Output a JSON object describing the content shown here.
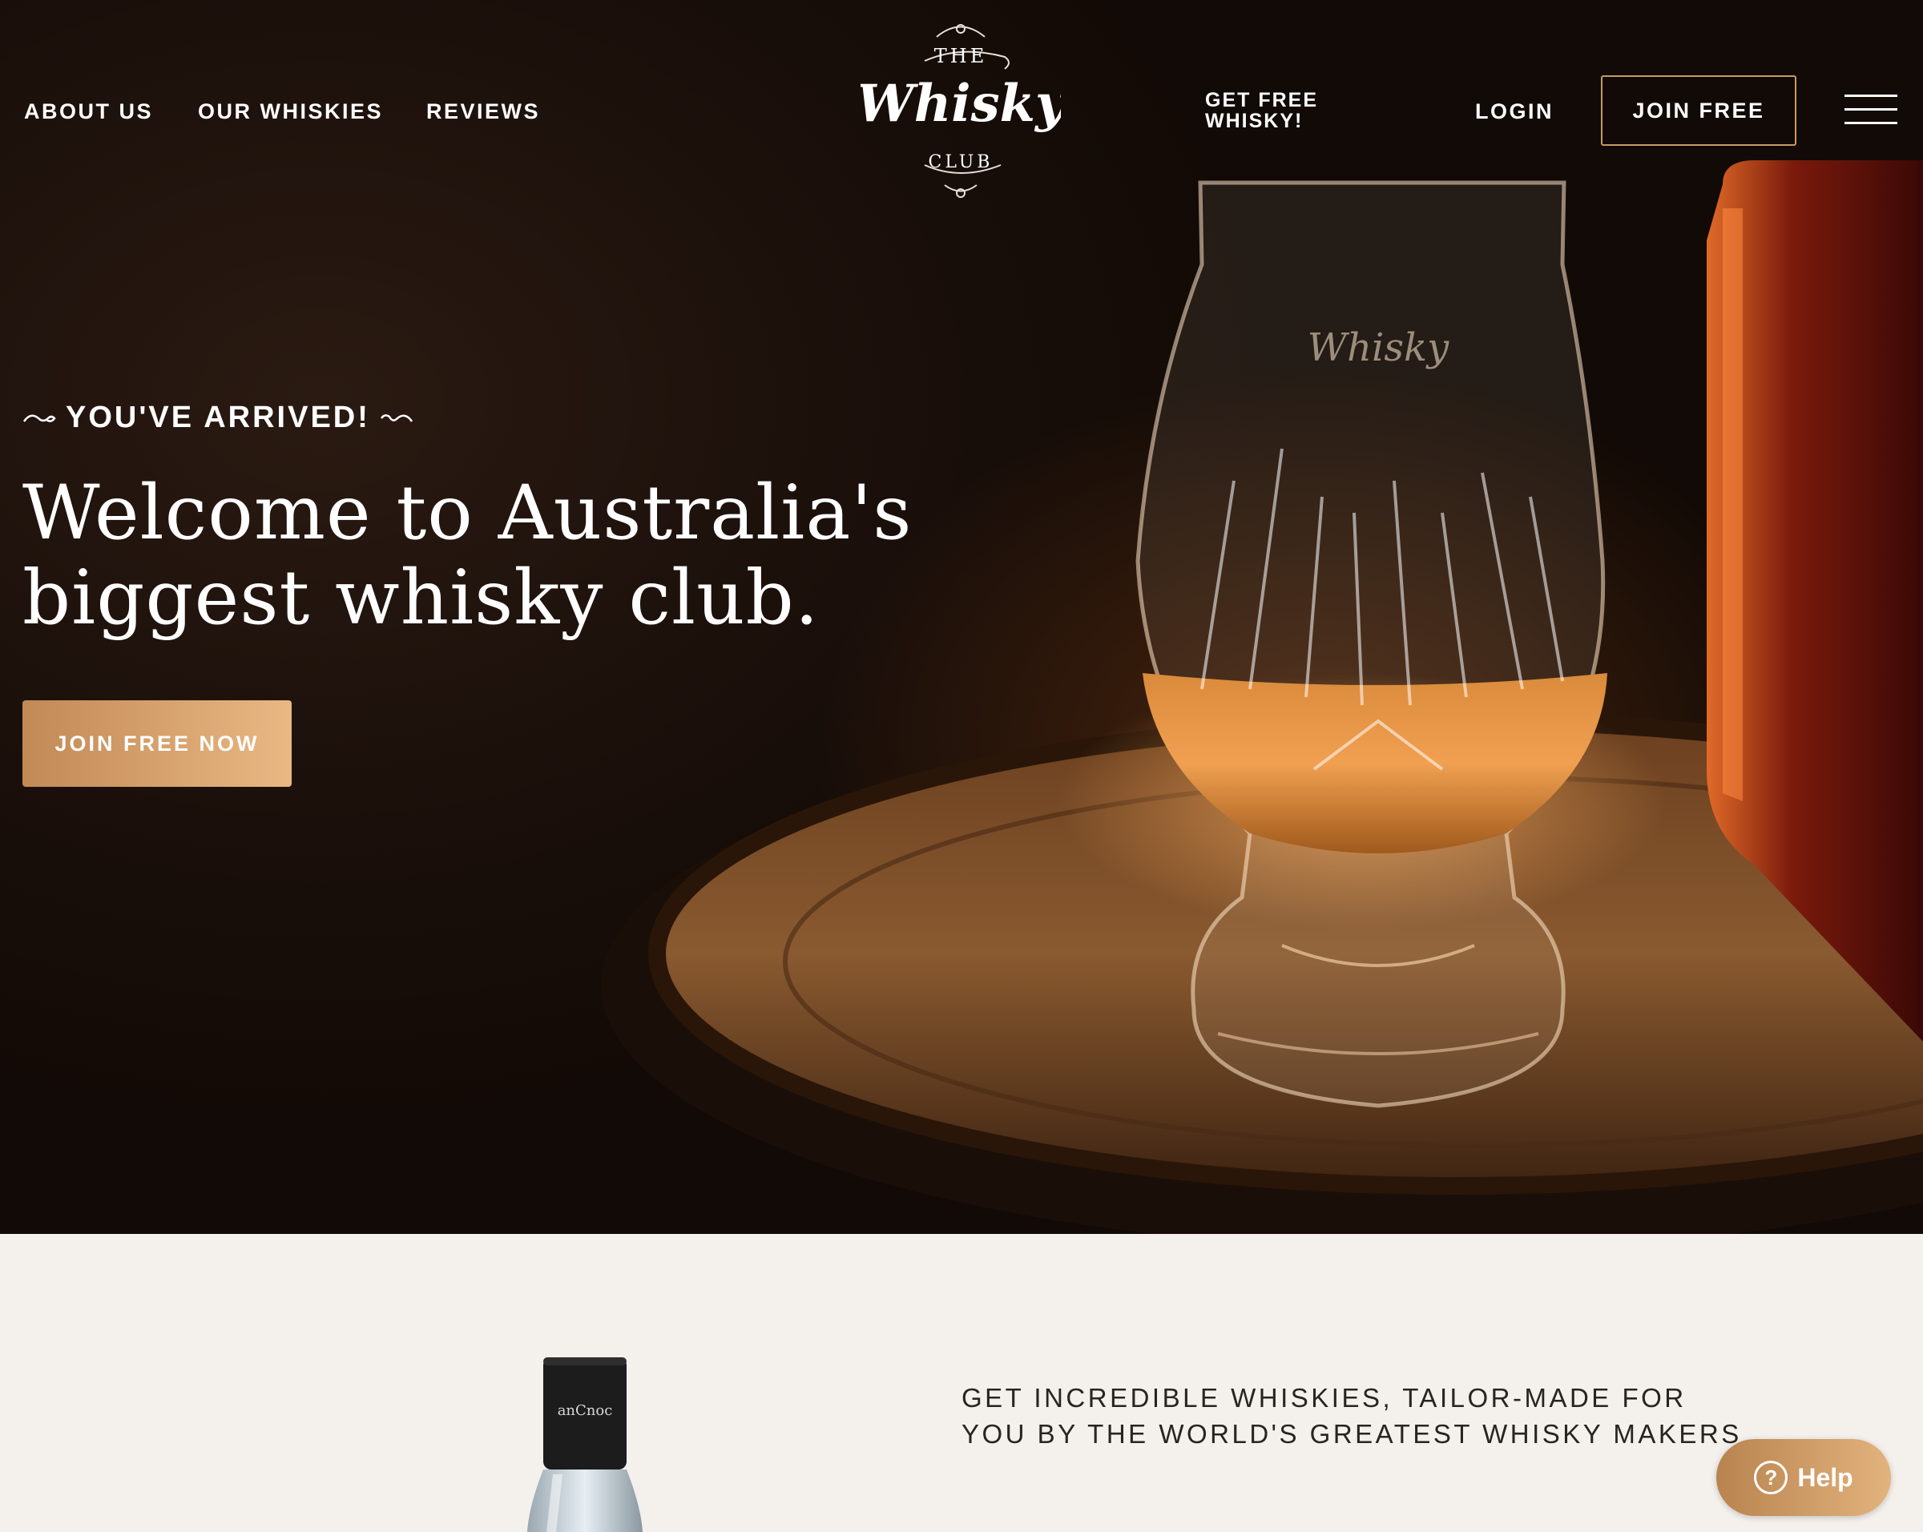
{
  "nav": {
    "about": "ABOUT US",
    "whiskies": "OUR WHISKIES",
    "reviews": "REVIEWS",
    "free_whisky": "GET FREE WHISKY!",
    "login": "LOGIN",
    "join": "JOIN FREE",
    "menu_icon": "hamburger-menu-icon"
  },
  "logo": {
    "line1": "THE",
    "line2": "Whisky",
    "line3": "CLUB"
  },
  "hero": {
    "eyebrow": "YOU'VE ARRIVED!",
    "headline_line1": "Welcome to Australia's",
    "headline_line2": "biggest whisky club.",
    "cta": "JOIN FREE NOW"
  },
  "feature": {
    "bottle_label": "anCnoc",
    "tagline_line1": "GET INCREDIBLE WHISKIES, TAILOR-MADE FOR",
    "tagline_line2": "YOU BY THE WORLD'S GREATEST WHISKY MAKERS"
  },
  "help": {
    "label": "Help",
    "icon": "question-circle-icon"
  },
  "colors": {
    "accent_gold": "#c89a63",
    "cta_gradient_start": "#c28955",
    "cta_gradient_end": "#e9b883",
    "page_bg": "#f4f0ec"
  }
}
